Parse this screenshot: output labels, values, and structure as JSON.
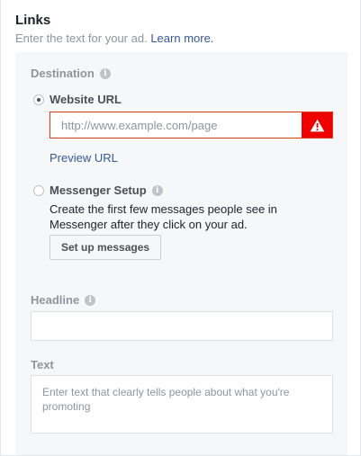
{
  "section": {
    "title": "Links",
    "subtitle": "Enter the text for your ad.",
    "learn_more": "Learn more."
  },
  "destination": {
    "label": "Destination",
    "website_url": {
      "label": "Website URL",
      "selected": true,
      "placeholder": "http://www.example.com/page",
      "value": "",
      "error": true
    },
    "preview_link": "Preview URL",
    "messenger": {
      "label": "Messenger Setup",
      "selected": false,
      "description": "Create the first few messages people see in Messenger after they click on your ad.",
      "button_label": "Set up messages"
    }
  },
  "headline": {
    "label": "Headline",
    "value": ""
  },
  "text": {
    "label": "Text",
    "placeholder": "Enter text that clearly tells people about what you're promoting",
    "value": ""
  },
  "colors": {
    "link": "#365899",
    "error": "#ee0000",
    "panel_bg": "#f6f7f9"
  }
}
